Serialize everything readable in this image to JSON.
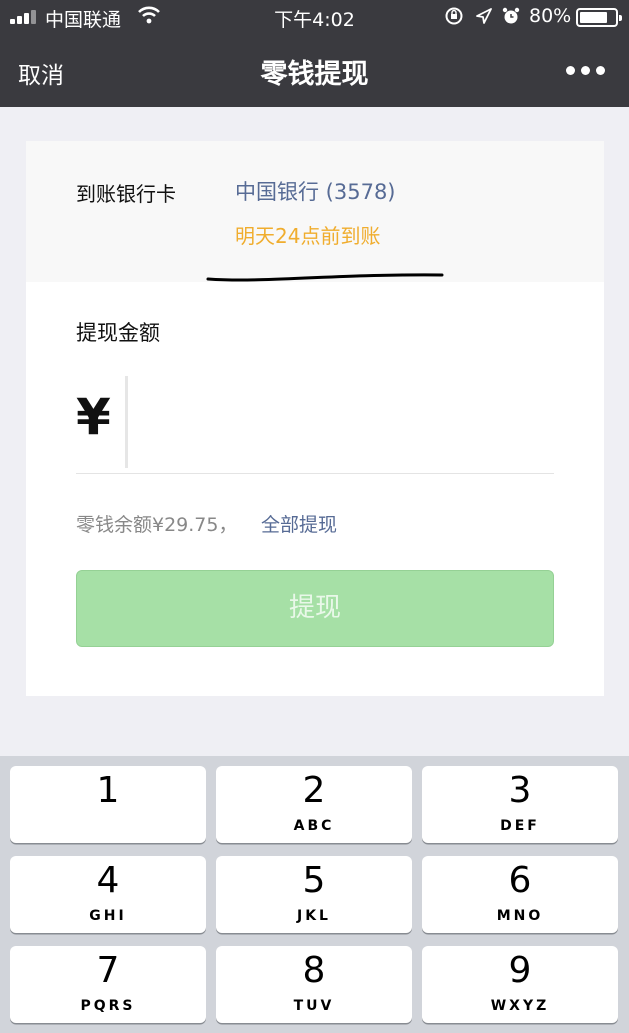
{
  "status_bar": {
    "carrier": "中国联通",
    "time": "下午4:02",
    "battery": "80%",
    "battery_level": 0.8
  },
  "nav": {
    "cancel": "取消",
    "title": "零钱提现",
    "more_icon": "more-dots-icon"
  },
  "bank": {
    "label": "到账银行卡",
    "name": "中国银行 (3578)",
    "arrival_time": "明天24点前到账"
  },
  "amount": {
    "label": "提现金额",
    "currency_symbol": "¥",
    "value": ""
  },
  "balance": {
    "text": "零钱余额¥29.75，",
    "withdraw_all": "全部提现"
  },
  "withdraw_button": "提现",
  "colors": {
    "nav_bg": "#3a3a3f",
    "link": "#576b95",
    "arrival": "#f0ad2e",
    "button_disabled": "#a6e0a6"
  },
  "keypad": [
    {
      "num": "1",
      "letters": ""
    },
    {
      "num": "2",
      "letters": "ABC"
    },
    {
      "num": "3",
      "letters": "DEF"
    },
    {
      "num": "4",
      "letters": "GHI"
    },
    {
      "num": "5",
      "letters": "JKL"
    },
    {
      "num": "6",
      "letters": "MNO"
    },
    {
      "num": "7",
      "letters": "PQRS"
    },
    {
      "num": "8",
      "letters": "TUV"
    },
    {
      "num": "9",
      "letters": "WXYZ"
    }
  ]
}
